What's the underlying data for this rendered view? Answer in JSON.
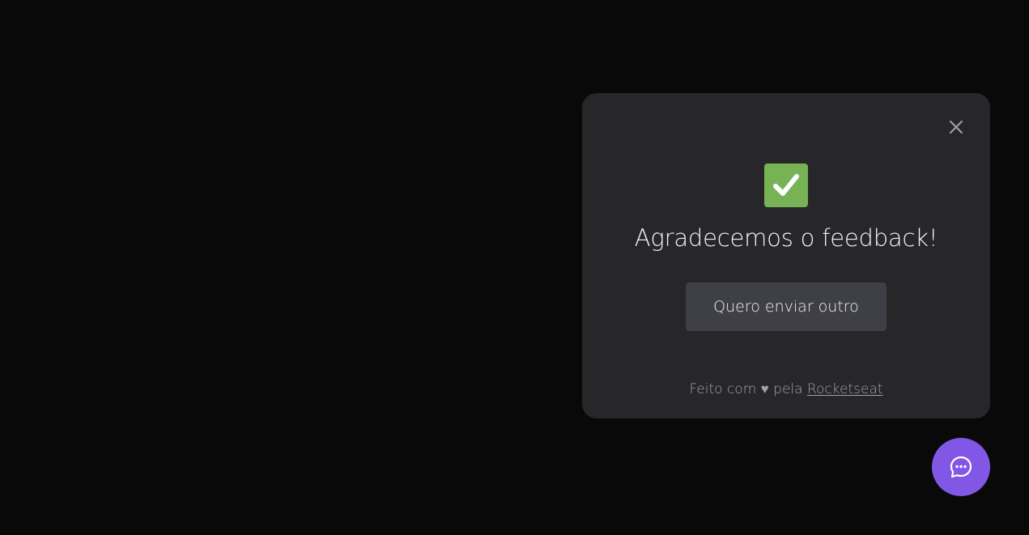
{
  "widget": {
    "title": "Agradecemos o feedback!",
    "send_another_label": "Quero enviar outro",
    "footer": {
      "prefix": "Feito com",
      "heart": "♥",
      "middle": "pela",
      "link_label": "Rocketseat"
    },
    "icons": {
      "close": "close-icon",
      "success": "check-mark-icon",
      "fab": "chat-bubble-dots-icon"
    }
  },
  "colors": {
    "background": "#09090a",
    "card": "#27272a",
    "button": "#3f3f46",
    "accent": "#8257e5",
    "success": "#77b255",
    "muted_text": "#a1a1aa",
    "text": "#f4f4f5"
  }
}
